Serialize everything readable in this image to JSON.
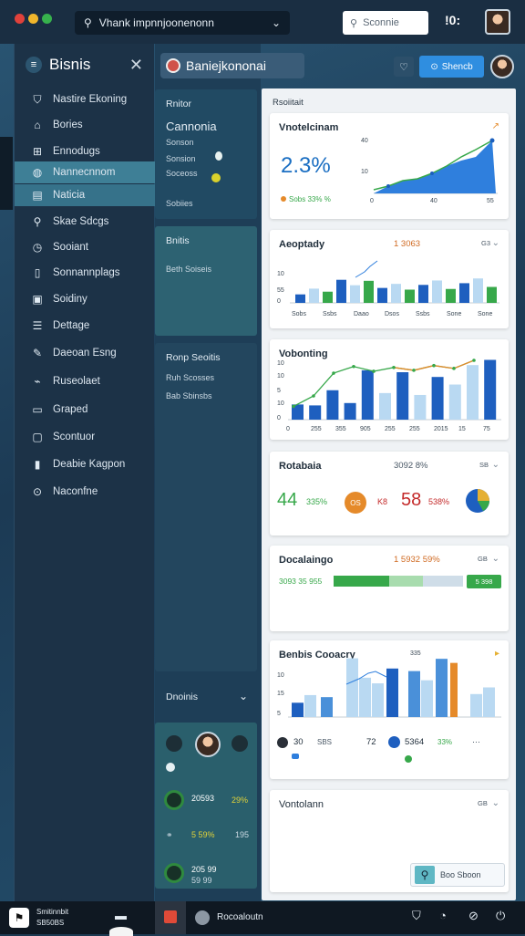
{
  "window": {
    "dots": [
      "#e0413b",
      "#f0b62c",
      "#37b24d"
    ],
    "address": "Vhank impnnjoonenonn",
    "search_placeholder": "Sconnie",
    "clock": "!0:"
  },
  "sidebar": {
    "title": "Bisnis",
    "items": [
      {
        "label": "Nastire Ekoning",
        "icon": "shield-icon"
      },
      {
        "label": "Bories",
        "icon": "home-icon"
      },
      {
        "label": "Ennodugs",
        "icon": "grid-icon"
      },
      {
        "label": "Nannecnnom",
        "icon": "globe-icon"
      },
      {
        "label": "Naticia",
        "icon": "document-icon"
      },
      {
        "label": "Skae Sdcgs",
        "icon": "search-icon"
      },
      {
        "label": "Sooiant",
        "icon": "clock-icon"
      },
      {
        "label": "Sonnannplags",
        "icon": "file-icon"
      },
      {
        "label": "Soidiny",
        "icon": "image-icon"
      },
      {
        "label": "Dettage",
        "icon": "list-icon"
      },
      {
        "label": "Daeoan Esng",
        "icon": "pen-icon"
      },
      {
        "label": "Ruseolaet",
        "icon": "tag-icon"
      },
      {
        "label": "Graped",
        "icon": "chat-icon"
      },
      {
        "label": "Scontuor",
        "icon": "box-icon"
      },
      {
        "label": "Deabie Kagpon",
        "icon": "bookmark-icon"
      },
      {
        "label": "Naconfne",
        "icon": "settings-icon"
      }
    ]
  },
  "header": {
    "title": "Baniejkononai",
    "action": "Shencb"
  },
  "middle": {
    "section1": {
      "title": "Rnitor",
      "heading": "Cannonia",
      "line1": "Sonson",
      "line2": "Sonsion",
      "line3": "Soceoss",
      "footer": "Sobiies"
    },
    "section2": {
      "title": "Bnitis",
      "line": "Beth Soiseis"
    },
    "section3": {
      "title": "Ronp Seoitis",
      "line1": "Ruh Scosses",
      "line2": "Bab Sbinsbs"
    },
    "section4": {
      "title": "Dnoinis",
      "stat1": "20593",
      "stat1b": "29%",
      "stat2": "5 59%",
      "stat2b": "195",
      "stat3": "205 99",
      "stat3b": "59 99"
    }
  },
  "content": {
    "label": "Rsoiitait"
  },
  "cards": [
    {
      "title": "Vnotelcinam",
      "big": "2.3%",
      "legend": "Sobs  33%  %",
      "axis": [
        "0",
        "40",
        "55"
      ],
      "yticks": [
        "10",
        "40"
      ]
    },
    {
      "title": "Aeoptady",
      "meta": "1 3063",
      "meta2": "G3",
      "xlabels": [
        "Sobs",
        "Ssbs",
        "Daao",
        "Dsos",
        "Ssbs",
        "Sone",
        "Sone"
      ],
      "values": [
        2.5,
        4.2,
        3.3,
        6.8,
        5.2,
        6.5,
        4.4,
        5.6,
        3.9,
        5.3,
        6.6,
        4.1,
        5.8,
        7.2,
        4.7
      ],
      "ylabels": [
        "10",
        "55",
        "0"
      ]
    },
    {
      "title": "Vobonting",
      "xlabels": [
        "0",
        "255",
        "355",
        "905",
        "255",
        "255",
        "2015",
        "15",
        "75"
      ],
      "bars": [
        3.2,
        3.0,
        6.2,
        3.5,
        10.4,
        5.6,
        10.0,
        5.2,
        9.0,
        7.4,
        11.5,
        12.6
      ],
      "line": [
        2.8,
        5.0,
        9.8,
        11.2,
        10.2,
        11.0,
        10.4,
        11.4,
        10.8,
        12.5
      ],
      "ylabels": [
        "10",
        "10",
        "5",
        "10",
        "0"
      ]
    },
    {
      "title": "Rotabaia",
      "meta": "3092 8%",
      "meta2": "SB",
      "stat1": "44",
      "stat1b": "335%",
      "badge": "OS",
      "stat2": "58",
      "stat2pre": "K8",
      "stat2b": "538%"
    },
    {
      "title": "Docalaingo",
      "meta": "1 5932 59%",
      "meta2": "GB",
      "progress_label": "3093 35 955",
      "progress": 0.62,
      "badge": "5 398"
    },
    {
      "title": "Benbis Cooacry",
      "meta": "335",
      "xlabels": [
        "10",
        "15",
        "5"
      ],
      "bars": [
        2.8,
        4.3,
        3.9,
        11.5,
        7.7,
        6.6,
        9.5,
        9.0,
        7.2,
        11.4,
        10.6,
        4.5,
        5.8
      ],
      "stat1": "30",
      "stat1b": "SBS",
      "stat2": "72",
      "stat3": "5364",
      "stat3b": "33%"
    },
    {
      "title": "Vontolann",
      "meta2": "GB",
      "search_label": "Boo Sboon"
    }
  ],
  "bottombar": {
    "label1": "Smitinnbit",
    "label2": "SB50BS",
    "app": "Rocoaloutn"
  },
  "colors": {
    "accent": "#2f8ee0",
    "dark_blue": "#1e5fbf",
    "mid_blue": "#4a90d9",
    "light_blue": "#b9d9f2",
    "green": "#37a84a",
    "orange": "#e58a2a",
    "panel": "#2b5a72"
  }
}
